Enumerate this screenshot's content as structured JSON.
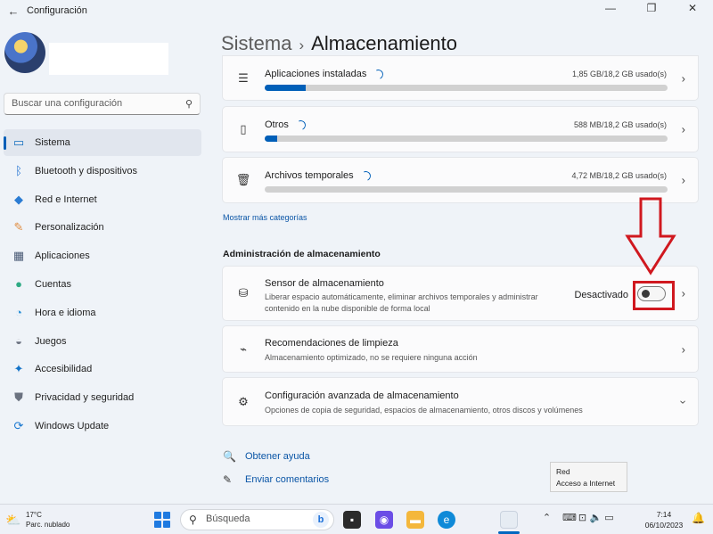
{
  "window": {
    "title": "Configuración",
    "back_icon": "arrow-left-icon",
    "controls": [
      "minimize-icon",
      "restore-icon",
      "close-icon"
    ]
  },
  "sidebar": {
    "search_placeholder": "Buscar una configuración",
    "items": [
      {
        "label": "Sistema",
        "icon": "monitor-icon",
        "color": "#0f6cbd",
        "active": true
      },
      {
        "label": "Bluetooth y dispositivos",
        "icon": "bluetooth-icon",
        "color": "#1c6fd1",
        "active": false
      },
      {
        "label": "Red e Internet",
        "icon": "wifi-icon",
        "color": "#2b7cd3",
        "active": false
      },
      {
        "label": "Personalización",
        "icon": "brush-icon",
        "color": "#e08a3c",
        "active": false
      },
      {
        "label": "Aplicaciones",
        "icon": "apps-icon",
        "color": "#4b5b76",
        "active": false
      },
      {
        "label": "Cuentas",
        "icon": "person-icon",
        "color": "#2faa84",
        "active": false
      },
      {
        "label": "Hora e idioma",
        "icon": "globe-clock-icon",
        "color": "#2a8fd6",
        "active": false
      },
      {
        "label": "Juegos",
        "icon": "gamepad-icon",
        "color": "#6b7280",
        "active": false
      },
      {
        "label": "Accesibilidad",
        "icon": "accessibility-icon",
        "color": "#1473c8",
        "active": false
      },
      {
        "label": "Privacidad y seguridad",
        "icon": "shield-icon",
        "color": "#6b7280",
        "active": false
      },
      {
        "label": "Windows Update",
        "icon": "update-icon",
        "color": "#1a78d0",
        "active": false
      }
    ]
  },
  "breadcrumb": {
    "parent": "Sistema",
    "separator": "›",
    "current": "Almacenamiento"
  },
  "usage": [
    {
      "label": "Aplicaciones instaladas",
      "icon": "list-icon",
      "value": "1,85 GB/18,2 GB usado(s)",
      "fraction": 0.102
    },
    {
      "label": "Otros",
      "icon": "document-icon",
      "value": "588 MB/18,2 GB usado(s)",
      "fraction": 0.032
    },
    {
      "label": "Archivos temporales",
      "icon": "trash-icon",
      "value": "4,72 MB/18,2 GB usado(s)",
      "fraction": 0.0
    }
  ],
  "more_link": "Mostrar más categorías",
  "management": {
    "title": "Administración de almacenamiento",
    "sensor": {
      "title": "Sensor de almacenamiento",
      "desc_line1": "Liberar espacio automáticamente, eliminar archivos temporales y administrar",
      "desc_line2": "contenido en la nube disponible de forma local",
      "state_label": "Desactivado",
      "enabled": false
    },
    "cleanup": {
      "title": "Recomendaciones de limpieza",
      "desc": "Almacenamiento optimizado, no se requiere ninguna acción"
    },
    "advanced": {
      "title": "Configuración avanzada de almacenamiento",
      "desc": "Opciones de copia de seguridad, espacios de almacenamiento, otros discos y volúmenes"
    }
  },
  "help": {
    "get_help": "Obtener ayuda",
    "feedback": "Enviar comentarios"
  },
  "tooltip": {
    "line1": "Red",
    "line2": "Acceso a Internet"
  },
  "taskbar": {
    "weather_temp": "17°C",
    "weather_desc": "Parc. nublado",
    "search_placeholder": "Búsqueda",
    "time": "7:14",
    "date": "06/10/2023"
  },
  "colors": {
    "accent": "#005fb8",
    "annotation_red": "#d0181f"
  }
}
